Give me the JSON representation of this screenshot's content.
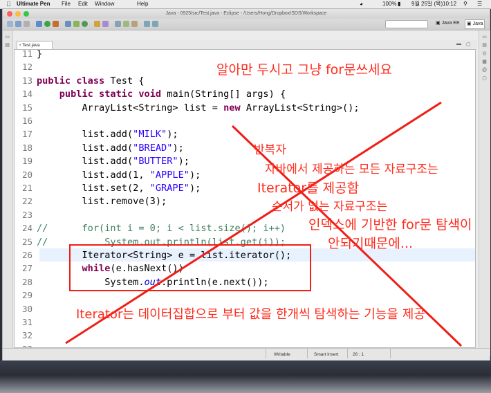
{
  "menubar": {
    "app_name": "Ultimate Pen",
    "items": [
      "File",
      "Edit",
      "Window",
      "Help"
    ],
    "battery": "100%",
    "date": "9월 25일 (목)",
    "time": "10:12"
  },
  "window": {
    "title": "Java - 0925/src/Test.java - Eclipse - /Users/Hong/Dropbox/SDS/Workspace",
    "perspective_java_ee": "Java EE",
    "perspective_java": "Java"
  },
  "editor": {
    "tab_label": "Test.java",
    "lines": [
      {
        "num": "11",
        "html": "}"
      },
      {
        "num": "12",
        "html": ""
      },
      {
        "num": "13",
        "html": "<span class=\"kw\">public class</span> Test {"
      },
      {
        "num": "14",
        "html": "    <span class=\"kw\">public static void</span> main(String[] args) {"
      },
      {
        "num": "15",
        "html": "        ArrayList&lt;String&gt; list = <span class=\"kw\">new</span> ArrayList&lt;String&gt;();"
      },
      {
        "num": "16",
        "html": ""
      },
      {
        "num": "17",
        "html": "        list.add(<span class=\"str\">\"MILK\"</span>);"
      },
      {
        "num": "18",
        "html": "        list.add(<span class=\"str\">\"BREAD\"</span>);"
      },
      {
        "num": "19",
        "html": "        list.add(<span class=\"str\">\"BUTTER\"</span>);"
      },
      {
        "num": "20",
        "html": "        list.add(1, <span class=\"str\">\"APPLE\"</span>);"
      },
      {
        "num": "21",
        "html": "        list.set(2, <span class=\"str\">\"GRAPE\"</span>);"
      },
      {
        "num": "22",
        "html": "        list.remove(3);"
      },
      {
        "num": "23",
        "html": ""
      },
      {
        "num": "24",
        "html": "<span class=\"cm\">//      for(int i = 0; i &lt; list.size(); i++)</span>"
      },
      {
        "num": "25",
        "html": "<span class=\"cm\">//          System.out.println(list.get(i));</span>"
      },
      {
        "num": "26",
        "html": "        Iterator&lt;String&gt; e = list.iterator();"
      },
      {
        "num": "27",
        "html": "        <span class=\"kw\">while</span>(e.hasNext())"
      },
      {
        "num": "28",
        "html": "            System.<span class=\"fld\">out</span>.println(e.next());"
      },
      {
        "num": "29",
        "html": ""
      },
      {
        "num": "30",
        "html": ""
      },
      {
        "num": "31",
        "html": ""
      },
      {
        "num": "32",
        "html": ""
      },
      {
        "num": "33",
        "html": ""
      }
    ]
  },
  "status": {
    "writable": "Writable",
    "insert_mode": "Smart Insert",
    "position": "26 : 1"
  },
  "annotations": {
    "top_note": "알아만 두시고 그냥 for문쓰세요",
    "note1": "반복자",
    "note2": "자바에서 제공하는 모든 자료구조는",
    "note3": "Iterator를 제공함",
    "note4": "순서가 없는 자료구조는",
    "note5": "인덱스에 기반한 for문 탐색이",
    "note6": "안되기때문에...",
    "bottom_note": "Iterator는 데이터집합으로 부터 값을 한개씩 탐색하는 기능을 제공"
  },
  "colors": {
    "annotation_red": "#ff2b1c",
    "keyword": "#7f0055",
    "string": "#2a00ff",
    "comment": "#3f7f5f"
  }
}
